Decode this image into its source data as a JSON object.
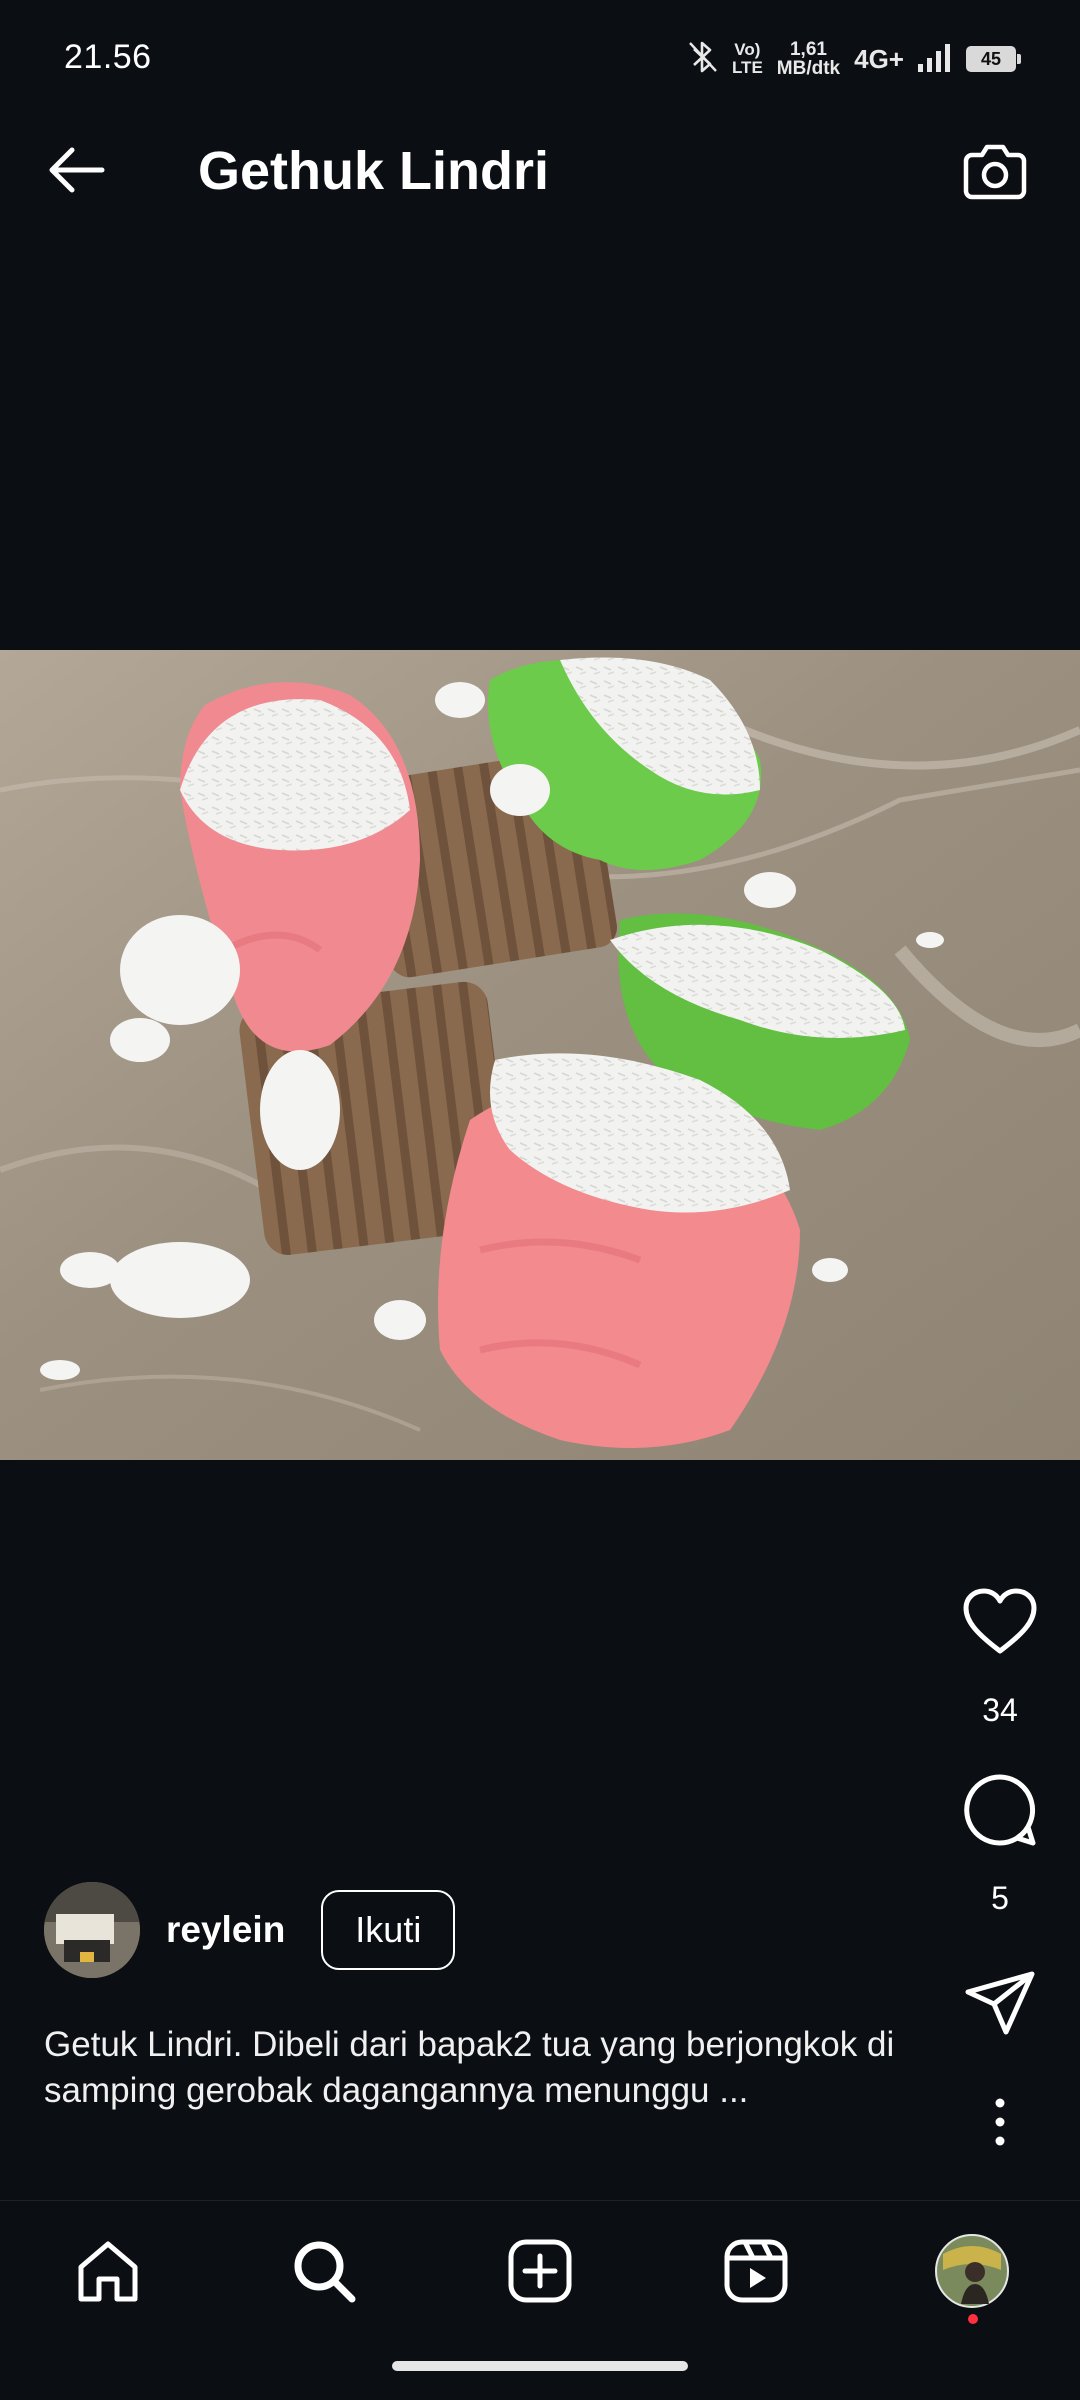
{
  "status_bar": {
    "time": "21.56",
    "volte_top": "Vo)",
    "volte_bottom": "LTE",
    "net_speed_value": "1,61",
    "net_speed_unit": "MB/dtk",
    "network_type": "4G+",
    "battery": "45",
    "icons": [
      "bluetooth-icon",
      "signal-icon"
    ]
  },
  "header": {
    "title": "Gethuk Lindri",
    "back_icon": "arrow-left-icon",
    "camera_icon": "camera-icon"
  },
  "post": {
    "author": "reylein",
    "follow_label": "Ikuti",
    "caption": "Getuk Lindri. Dibeli dari bapak2 tua yang berjongkok di samping gerobak dagangannya menunggu ...",
    "likes": "34",
    "comments": "5",
    "actions": [
      "heart-icon",
      "comment-icon",
      "share-icon",
      "more-icon"
    ]
  },
  "bottom_nav": {
    "items": [
      "home",
      "search",
      "create",
      "reels",
      "profile"
    ],
    "active": "search",
    "notification_dot_color": "#ff3040"
  }
}
